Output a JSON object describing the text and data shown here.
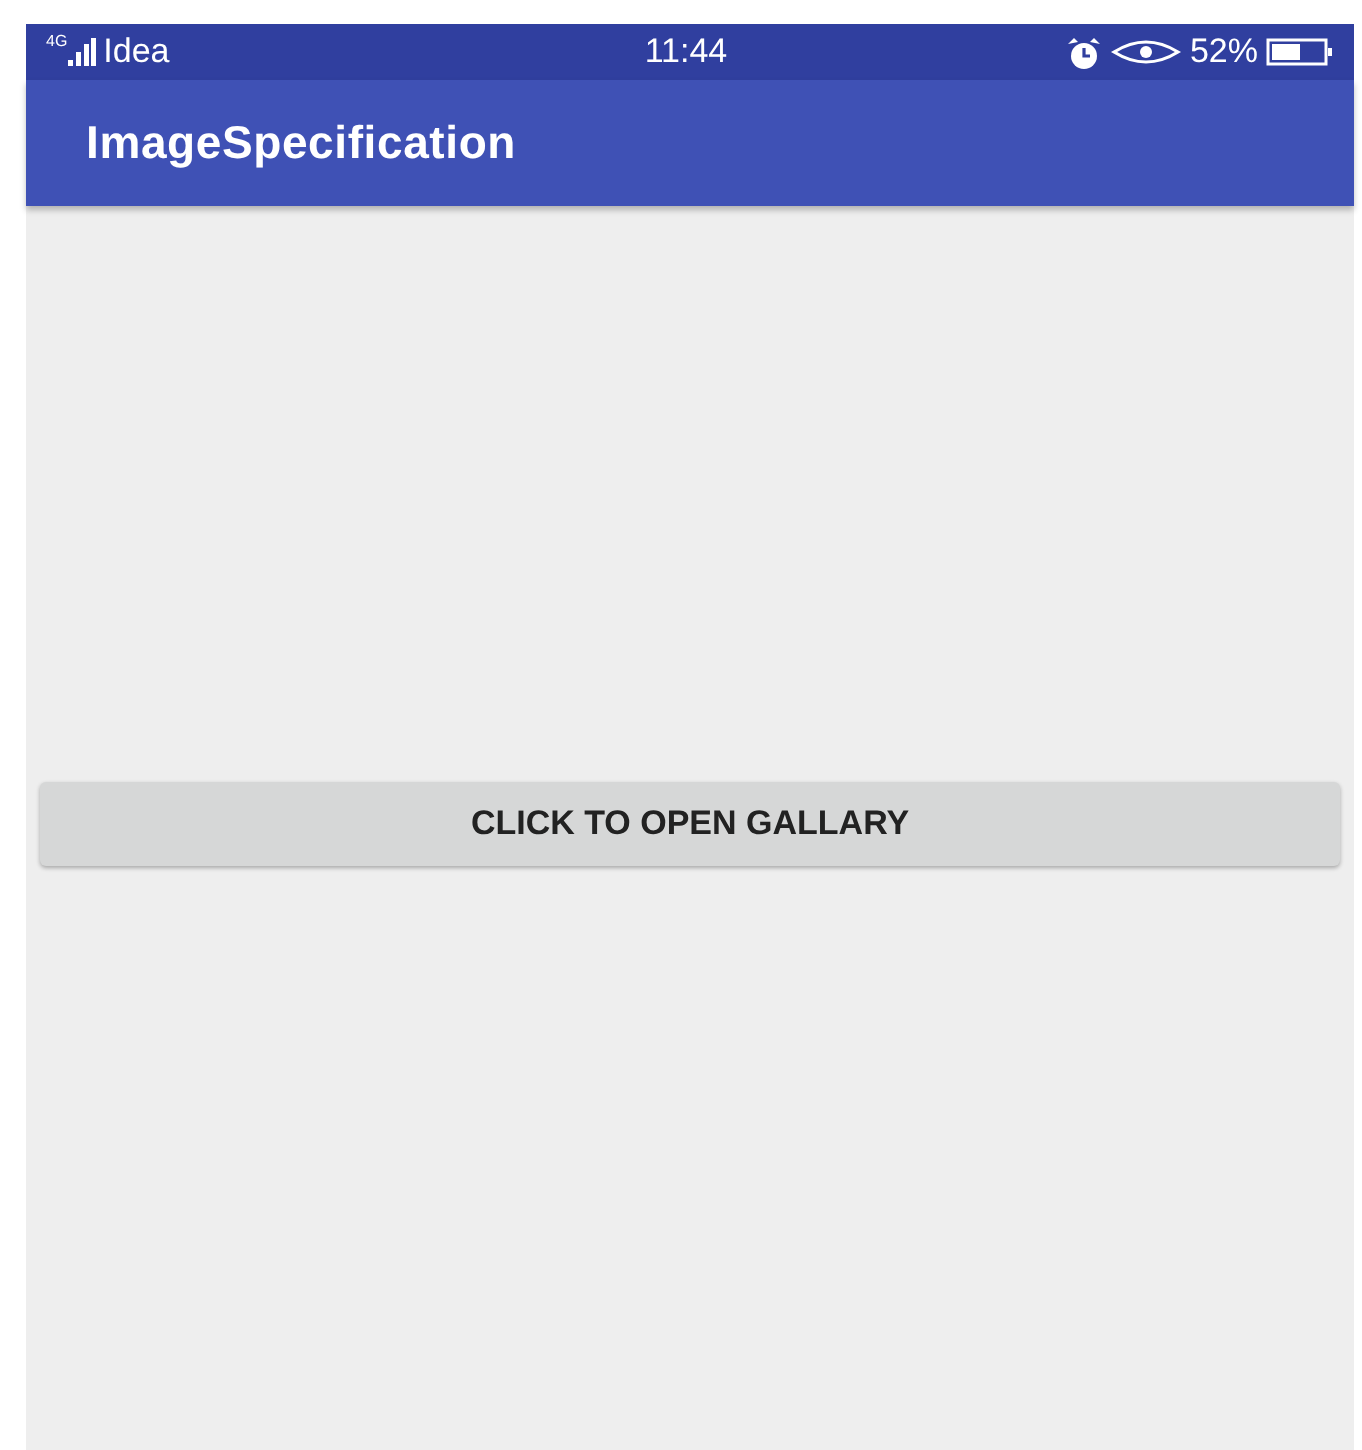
{
  "status_bar": {
    "network_type": "4G",
    "carrier": "Idea",
    "time": "11:44",
    "battery": "52%"
  },
  "app_bar": {
    "title": "ImageSpecification"
  },
  "button": {
    "label": "CLICK TO OPEN GALLARY"
  }
}
